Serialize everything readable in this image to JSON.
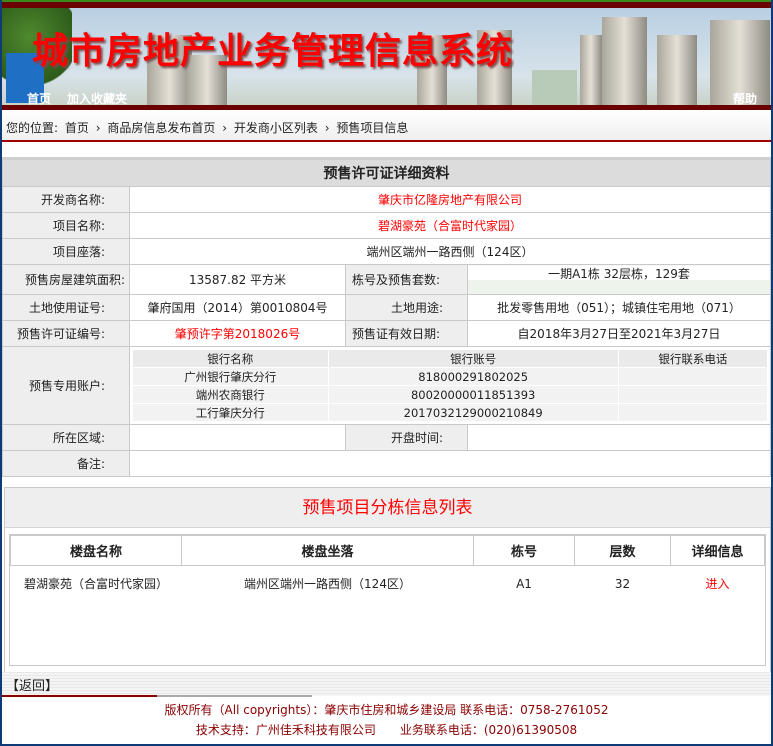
{
  "header": {
    "title": "城市房地产业务管理信息系统",
    "nav_home": "首页",
    "nav_favorite": "加入收藏夹",
    "nav_help": "帮助"
  },
  "breadcrumb": {
    "prefix": "您的位置:",
    "items": [
      "首页",
      "商品房信息发布首页",
      "开发商小区列表",
      "预售项目信息"
    ],
    "sep": "›"
  },
  "detail": {
    "title": "预售许可证详细资料",
    "developer_label": "开发商名称:",
    "developer": "肇庆市亿隆房地产有限公司",
    "project_label": "项目名称:",
    "project": "碧湖豪苑（合富时代家园）",
    "location_label": "项目座落:",
    "location": "端州区端州一路西侧（124区）",
    "area_label": "预售房屋建筑面积:",
    "area": "13587.82 平方米",
    "building_label": "栋号及预售套数:",
    "building": "一期A1栋 32层栋，129套",
    "land_cert_label": "土地使用证号:",
    "land_cert": "肇府国用（2014）第0010804号",
    "land_use_label": "土地用途:",
    "land_use": "批发零售用地（051）；城镇住宅用地（071）",
    "permit_label": "预售许可证编号:",
    "permit": "肇预许字第2018026号",
    "valid_label": "预售证有效日期:",
    "valid": "自2018年3月27日至2021年3月27日",
    "account_label": "预售专用账户:",
    "bank_headers": [
      "银行名称",
      "银行账号",
      "银行联系电话"
    ],
    "banks": [
      [
        "广州银行肇庆分行",
        "818000291802025",
        ""
      ],
      [
        "端州农商银行",
        "80020000011851393",
        ""
      ],
      [
        "工行肇庆分行",
        "2017032129000210849",
        ""
      ]
    ],
    "region_label": "所在区域:",
    "region": "",
    "open_label": "开盘时间:",
    "open": "",
    "remark_label": "备注:",
    "remark": ""
  },
  "buildings": {
    "title": "预售项目分栋信息列表",
    "headers": [
      "楼盘名称",
      "楼盘坐落",
      "栋号",
      "层数",
      "详细信息"
    ],
    "rows": [
      {
        "name": "碧湖豪苑（合富时代家园）",
        "location": "端州区端州一路西侧（124区）",
        "building": "A1",
        "floors": "32",
        "link": "进入"
      }
    ]
  },
  "back_label": "【返回】",
  "footer": {
    "line1": "版权所有（All copyrights）：肇庆市住房和城乡建设局 联系电话：0758-2761052",
    "line2": "技术支持：广州佳禾科技有限公司　　业务联系电话：(020)61390508"
  }
}
